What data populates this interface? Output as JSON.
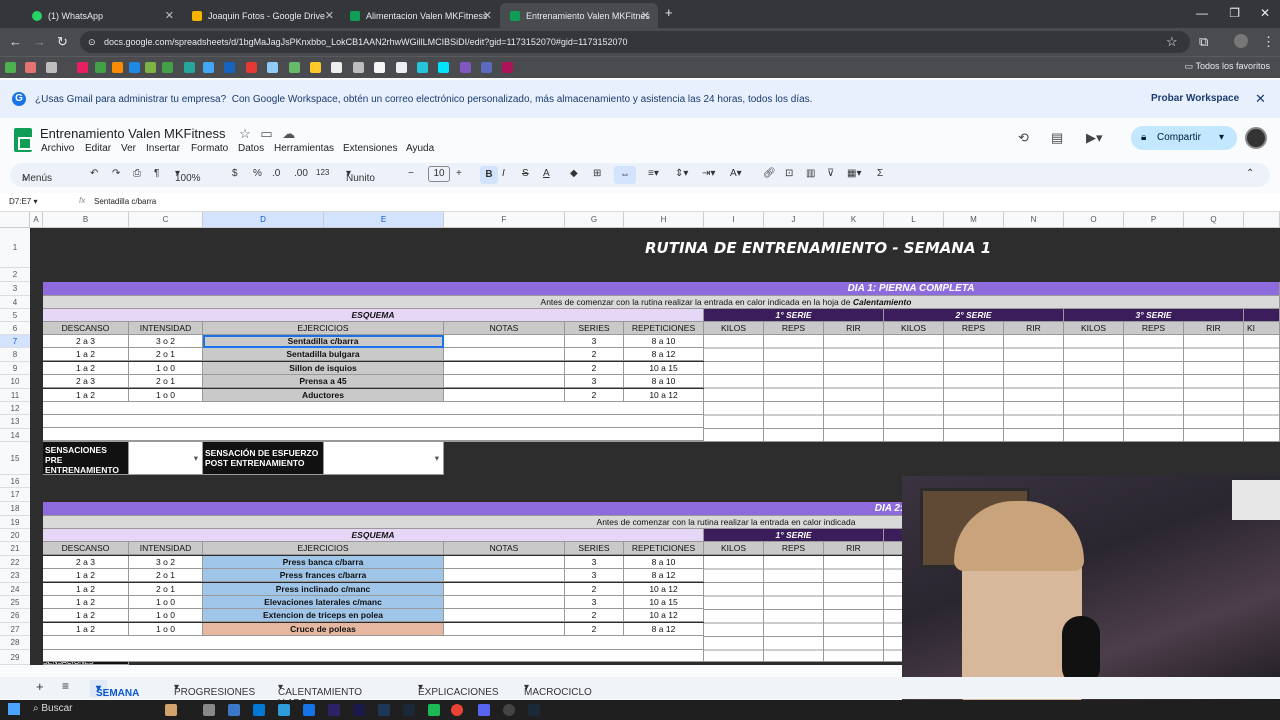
{
  "browser": {
    "tabs": [
      "(1) WhatsApp",
      "Joaquin Fotos - Google Drive",
      "Alimentacion Valen MKFitness",
      "Entrenamiento Valen MKFitnes"
    ],
    "url": "docs.google.com/spreadsheets/d/1bgMaJagJsPKnxbbo_LokCB1AAN2rhwWGillLMCIBSiDI/edit?gid=1173152070#gid=1173152070",
    "bookmarks_right": "Todos los favoritos"
  },
  "banner": {
    "question": "¿Usas Gmail para administrar tu empresa?",
    "text": "Con Google Workspace, obtén un correo electrónico personalizado, más almacenamiento y asistencia las 24 horas, todos los días.",
    "cta": "Probar Workspace"
  },
  "doc": {
    "title": "Entrenamiento Valen MKFitness",
    "menus": [
      "Archivo",
      "Editar",
      "Ver",
      "Insertar",
      "Formato",
      "Datos",
      "Herramientas",
      "Extensiones",
      "Ayuda"
    ],
    "share": "Compartir"
  },
  "toolbar": {
    "menus": "Menús",
    "zoom": "100%",
    "currency": "$",
    "percent": "%",
    "dec_less": ".0",
    "dec_more": ".00",
    "num": "123",
    "font": "Nunito",
    "size": "10"
  },
  "formula": {
    "ref": "D7:E7",
    "value": "Sentadilla c/barra"
  },
  "columns": [
    "A",
    "B",
    "C",
    "D",
    "E",
    "F",
    "G",
    "H",
    "I",
    "J",
    "K",
    "L",
    "M",
    "N",
    "O",
    "P",
    "Q"
  ],
  "rows": [
    "1",
    "2",
    "3",
    "4",
    "5",
    "6",
    "7",
    "8",
    "9",
    "10",
    "11",
    "12",
    "13",
    "14",
    "15",
    "16",
    "17",
    "18",
    "19",
    "20",
    "21",
    "22",
    "23",
    "24",
    "25",
    "26",
    "27",
    "28",
    "29"
  ],
  "sheet": {
    "title": "RUTINA DE ENTRENAMIENTO - SEMANA 1",
    "day1": "DIA 1: PIERNA COMPLETA",
    "day2": "DIA 2: EMPUJE",
    "intro_text": "Antes de comenzar con la rutina realizar la entrada en calor indicada en la hoja de",
    "intro_bold": "Calentamiento",
    "intro_truncated": "Antes de comenzar con la rutina realizar la entrada en calor indicada",
    "esquema": "ESQUEMA",
    "serie1": "1° SERIE",
    "serie2": "2° SERIE",
    "serie3": "3° SERIE",
    "headers": [
      "DESCANSO",
      "INTENSIDAD",
      "EJERCICIOS",
      "NOTAS",
      "SERIES",
      "REPETICIONES"
    ],
    "serie_headers": [
      "KILOS",
      "REPS",
      "RIR",
      "KILOS",
      "REPS",
      "RIR",
      "KILOS",
      "REPS",
      "RIR",
      "KI"
    ],
    "day1_rows": [
      {
        "descanso": "2 a 3",
        "intensidad": "3 o 2",
        "ejercicio": "Sentadilla c/barra",
        "series": "3",
        "reps": "8 a 10"
      },
      {
        "descanso": "1 a 2",
        "intensidad": "2 o 1",
        "ejercicio": "Sentadilla bulgara",
        "series": "2",
        "reps": "8 a 12"
      },
      {
        "descanso": "1 a 2",
        "intensidad": "1 o 0",
        "ejercicio": "Sillon de isquios",
        "series": "2",
        "reps": "10 a 15"
      },
      {
        "descanso": "2 a 3",
        "intensidad": "2 o 1",
        "ejercicio": "Prensa a 45",
        "series": "3",
        "reps": "8 a 10"
      },
      {
        "descanso": "1 a 2",
        "intensidad": "1 o 0",
        "ejercicio": "Aductores",
        "series": "2",
        "reps": "10 a 12"
      }
    ],
    "day2_rows": [
      {
        "descanso": "2 a 3",
        "intensidad": "3 o 2",
        "ejercicio": "Press banca c/barra",
        "series": "3",
        "reps": "8 a 10"
      },
      {
        "descanso": "1 a 2",
        "intensidad": "2 o 1",
        "ejercicio": "Press frances c/barra",
        "series": "3",
        "reps": "8 a 12"
      },
      {
        "descanso": "1 a 2",
        "intensidad": "2 o 1",
        "ejercicio": "Press inclinado c/manc",
        "series": "2",
        "reps": "10 a 12"
      },
      {
        "descanso": "1 a 2",
        "intensidad": "1 o 0",
        "ejercicio": "Elevaciones laterales c/manc",
        "series": "3",
        "reps": "10 a 15"
      },
      {
        "descanso": "1 a 2",
        "intensidad": "1 o 0",
        "ejercicio": "Extencion de triceps en polea",
        "series": "2",
        "reps": "10 a 12"
      },
      {
        "descanso": "1 a 2",
        "intensidad": "1 o 0",
        "ejercicio": "Cruce de poleas",
        "series": "2",
        "reps": "8 a 12"
      }
    ],
    "sens_pre": "SENSACIONES PRE ENTRENAMIENTO",
    "sens_post": "SENSACIÓN DE ESFUERZO POST ENTRENAMIENTO",
    "sens_partial": "SENSACIONES"
  },
  "sheet_tabs": [
    "SEMANA 1",
    "PROGRESIONES",
    "CALENTAMIENTO Y ABS",
    "EXPLICACIONES",
    "MACROCICLO"
  ],
  "taskbar": {
    "search": "Buscar"
  },
  "colors": {
    "purple": "#8e6bdc",
    "purple_dark": "#3c1d5c",
    "lavender": "#e6d7f7",
    "gray": "#c9c9c9",
    "blue": "#9fc5e8",
    "peach": "#e6b8a2"
  }
}
